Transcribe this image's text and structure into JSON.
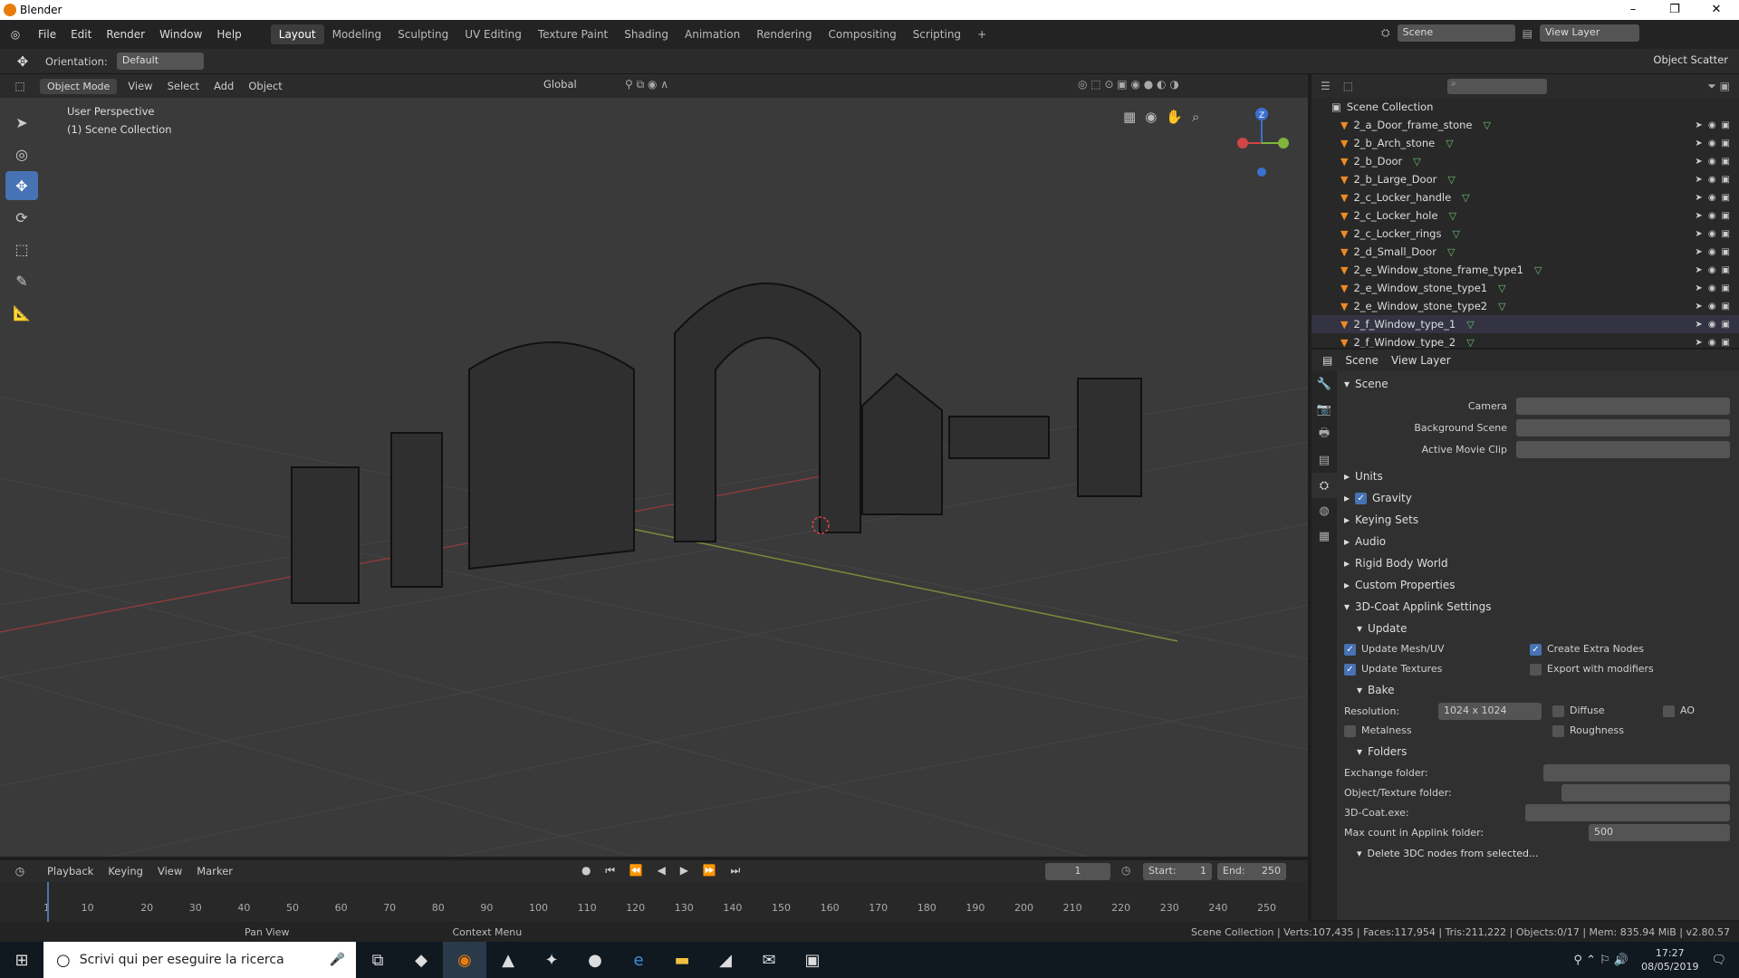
{
  "window": {
    "title": "Blender",
    "minimize": "–",
    "maximize": "❐",
    "close": "✕"
  },
  "menus": [
    "File",
    "Edit",
    "Render",
    "Window",
    "Help"
  ],
  "workspaces": [
    "Layout",
    "Modeling",
    "Sculpting",
    "UV Editing",
    "Texture Paint",
    "Shading",
    "Animation",
    "Rendering",
    "Compositing",
    "Scripting",
    "+"
  ],
  "scene": {
    "label": "Scene",
    "view_layer": "View Layer"
  },
  "tool_header": {
    "orientation_label": "Orientation:",
    "orientation_value": "Default",
    "object_scatter": "Object Scatter"
  },
  "viewport_header": {
    "mode": "Object Mode",
    "items": [
      "View",
      "Select",
      "Add",
      "Object"
    ],
    "transform": "Global"
  },
  "viewport": {
    "perspective": "User Perspective",
    "collection": "(1) Scene Collection",
    "gizmo_axis": "Z"
  },
  "outliner": {
    "root": "Scene Collection",
    "items": [
      "2_a_Door_frame_stone",
      "2_b_Arch_stone",
      "2_b_Door",
      "2_b_Large_Door",
      "2_c_Locker_handle",
      "2_c_Locker_hole",
      "2_c_Locker_rings",
      "2_d_Small_Door",
      "2_e_Window_stone_frame_type1",
      "2_e_Window_stone_type1",
      "2_e_Window_stone_type2",
      "2_f_Window_type_1",
      "2_f_Window_type_2"
    ]
  },
  "properties": {
    "tabs": [
      "Scene",
      "View Layer"
    ],
    "scene_section": "Scene",
    "camera_label": "Camera",
    "bg_scene_label": "Background Scene",
    "movie_clip_label": "Active Movie Clip",
    "panels": [
      "Units",
      "Gravity",
      "Keying Sets",
      "Audio",
      "Rigid Body World",
      "Custom Properties",
      "3D-Coat Applink Settings"
    ],
    "update": "Update",
    "update_mesh": "Update Mesh/UV",
    "create_nodes": "Create Extra Nodes",
    "update_textures": "Update Textures",
    "export_mod": "Export with modifiers",
    "bake": "Bake",
    "resolution_label": "Resolution:",
    "resolution_value": "1024 x 1024",
    "diffuse": "Diffuse",
    "ao": "AO",
    "metalness": "Metalness",
    "roughness": "Roughness",
    "folders": "Folders",
    "exchange": "Exchange folder:",
    "objtex": "Object/Texture folder:",
    "coat_exe": "3D-Coat.exe:",
    "max_count": "Max count in Applink folder:",
    "max_count_value": "500",
    "delete": "Delete 3DC nodes from selected..."
  },
  "timeline": {
    "menus": [
      "Playback",
      "Keying",
      "View",
      "Marker"
    ],
    "frame": "1",
    "start_label": "Start:",
    "start": "1",
    "end_label": "End:",
    "end": "250",
    "ticks": [
      "1",
      "10",
      "20",
      "30",
      "40",
      "50",
      "60",
      "70",
      "80",
      "90",
      "100",
      "110",
      "120",
      "130",
      "140",
      "150",
      "160",
      "170",
      "180",
      "190",
      "200",
      "210",
      "220",
      "230",
      "240",
      "250"
    ]
  },
  "status": {
    "pan": "Pan View",
    "context": "Context Menu",
    "info": "Scene Collection | Verts:107,435 | Faces:117,954 | Tris:211,222 | Objects:0/17 | Mem: 835.94 MiB | v2.80.57"
  },
  "taskbar": {
    "search": "Scrivi qui per eseguire la ricerca",
    "time": "17:27",
    "date": "08/05/2019"
  },
  "colors": {
    "accent": "#4772b3",
    "object_orange": "#ee8a24",
    "mesh_green": "#6fc06f"
  }
}
